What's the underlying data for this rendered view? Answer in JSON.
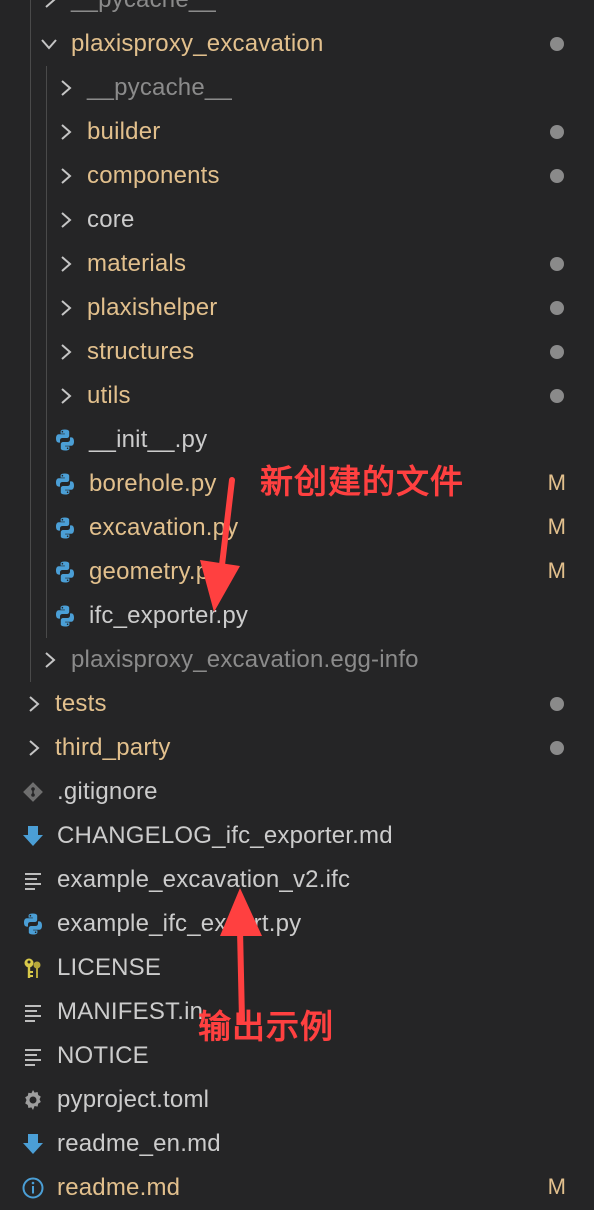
{
  "explorer": {
    "items": [
      {
        "label": "__pycache__",
        "depth": 1,
        "kind": "folder",
        "open": false,
        "color": "dim"
      },
      {
        "label": "plaxisproxy_excavation",
        "depth": 1,
        "kind": "folder",
        "open": true,
        "color": "mod",
        "dot": true
      },
      {
        "label": "__pycache__",
        "depth": 2,
        "kind": "folder",
        "open": false,
        "color": "dim"
      },
      {
        "label": "builder",
        "depth": 2,
        "kind": "folder",
        "open": false,
        "color": "mod",
        "dot": true
      },
      {
        "label": "components",
        "depth": 2,
        "kind": "folder",
        "open": false,
        "color": "mod",
        "dot": true
      },
      {
        "label": "core",
        "depth": 2,
        "kind": "folder",
        "open": false,
        "color": "norm"
      },
      {
        "label": "materials",
        "depth": 2,
        "kind": "folder",
        "open": false,
        "color": "mod",
        "dot": true
      },
      {
        "label": "plaxishelper",
        "depth": 2,
        "kind": "folder",
        "open": false,
        "color": "mod",
        "dot": true
      },
      {
        "label": "structures",
        "depth": 2,
        "kind": "folder",
        "open": false,
        "color": "mod",
        "dot": true
      },
      {
        "label": "utils",
        "depth": 2,
        "kind": "folder",
        "open": false,
        "color": "mod",
        "dot": true
      },
      {
        "label": "__init__.py",
        "depth": 2,
        "kind": "file",
        "icon": "python-icon",
        "color": "norm"
      },
      {
        "label": "borehole.py",
        "depth": 2,
        "kind": "file",
        "icon": "python-icon",
        "color": "mod",
        "badge": "M"
      },
      {
        "label": "excavation.py",
        "depth": 2,
        "kind": "file",
        "icon": "python-icon",
        "color": "mod",
        "badge": "M"
      },
      {
        "label": "geometry.py",
        "depth": 2,
        "kind": "file",
        "icon": "python-icon",
        "color": "mod",
        "badge": "M"
      },
      {
        "label": "ifc_exporter.py",
        "depth": 2,
        "kind": "file",
        "icon": "python-icon",
        "color": "norm"
      },
      {
        "label": "plaxisproxy_excavation.egg-info",
        "depth": 1,
        "kind": "folder",
        "open": false,
        "color": "dim"
      },
      {
        "label": "tests",
        "depth": 0,
        "kind": "folder",
        "open": false,
        "color": "mod",
        "dot": true
      },
      {
        "label": "third_party",
        "depth": 0,
        "kind": "folder",
        "open": false,
        "color": "mod",
        "dot": true
      },
      {
        "label": ".gitignore",
        "depth": 0,
        "kind": "file",
        "icon": "git-icon",
        "color": "norm"
      },
      {
        "label": "CHANGELOG_ifc_exporter.md",
        "depth": 0,
        "kind": "file",
        "icon": "markdown-download-icon",
        "color": "norm"
      },
      {
        "label": "example_excavation_v2.ifc",
        "depth": 0,
        "kind": "file",
        "icon": "text-lines-icon",
        "color": "norm"
      },
      {
        "label": "example_ifc_export.py",
        "depth": 0,
        "kind": "file",
        "icon": "python-icon",
        "color": "norm"
      },
      {
        "label": "LICENSE",
        "depth": 0,
        "kind": "file",
        "icon": "license-key-icon",
        "color": "norm"
      },
      {
        "label": "MANIFEST.in",
        "depth": 0,
        "kind": "file",
        "icon": "text-lines-icon",
        "color": "norm"
      },
      {
        "label": "NOTICE",
        "depth": 0,
        "kind": "file",
        "icon": "text-lines-icon",
        "color": "norm"
      },
      {
        "label": "pyproject.toml",
        "depth": 0,
        "kind": "file",
        "icon": "gear-icon",
        "color": "norm"
      },
      {
        "label": "readme_en.md",
        "depth": 0,
        "kind": "file",
        "icon": "markdown-download-icon",
        "color": "norm"
      },
      {
        "label": "readme.md",
        "depth": 0,
        "kind": "file",
        "icon": "info-icon",
        "color": "mod",
        "badge": "M"
      }
    ]
  },
  "annotations": {
    "new_files": "新创建的文件",
    "output_example": "输出示例"
  },
  "colors": {
    "background": "#252526",
    "modified": "#e2c08d",
    "normal": "#cccccc",
    "dimmed": "#8b8b8b",
    "dot": "#8a8a8a",
    "python_blue": "#4b9fd6",
    "annotation": "#ff4040"
  }
}
